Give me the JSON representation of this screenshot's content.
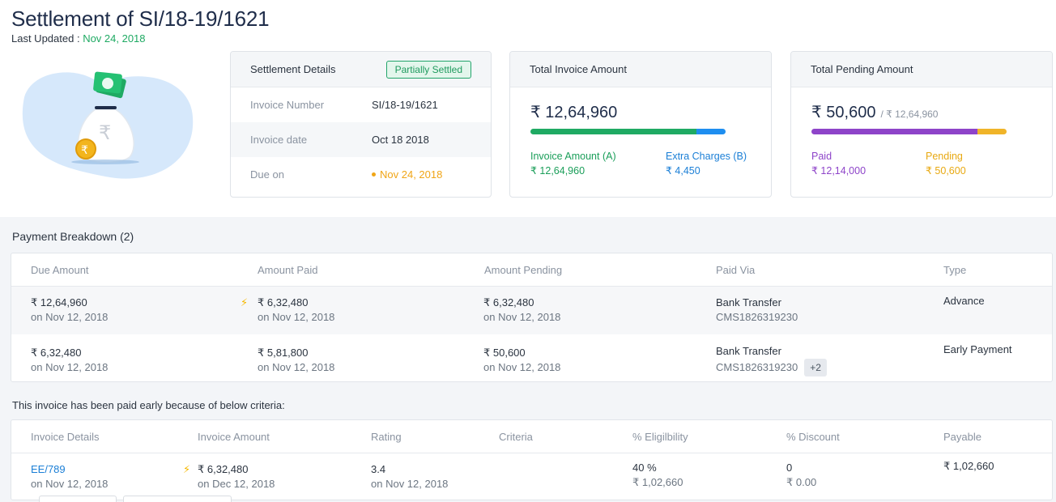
{
  "header": {
    "title": "Settlement of SI/18-19/1621",
    "last_updated_label": "Last Updated :",
    "last_updated_value": "Nov 24, 2018"
  },
  "colors": {
    "green": "#1faa63",
    "blue": "#1b7fd6",
    "purple": "#8e44c9",
    "amber": "#f0b429",
    "text": "#2b3440"
  },
  "settlement_card": {
    "title": "Settlement Details",
    "status_badge": "Partially Settled",
    "rows": [
      {
        "label": "Invoice Number",
        "value": "SI/18-19/1621"
      },
      {
        "label": "Invoice date",
        "value": "Oct 18 2018"
      },
      {
        "label": "Due on",
        "value": "Nov 24, 2018"
      }
    ]
  },
  "total_invoice_card": {
    "title": "Total Invoice Amount",
    "amount": "₹ 12,64,960",
    "bar_fraction_invoice": 0.85,
    "legend": [
      {
        "label": "Invoice Amount (A)",
        "value": "₹ 12,64,960"
      },
      {
        "label": "Extra Charges (B)",
        "value": "₹ 4,450"
      }
    ]
  },
  "total_pending_card": {
    "title": "Total Pending Amount",
    "amount": "₹ 50,600",
    "of_total": "/ ₹ 12,64,960",
    "bar_fraction_paid": 0.85,
    "legend": [
      {
        "label": "Paid",
        "value": "₹ 12,14,000"
      },
      {
        "label": "Pending",
        "value": "₹ 50,600"
      }
    ]
  },
  "payment_breakdown": {
    "title": "Payment Breakdown (2)",
    "columns": [
      "Due Amount",
      "Amount Paid",
      "Amount Pending",
      "Paid Via",
      "Type"
    ],
    "rows": [
      {
        "due_amount": "₹ 12,64,960",
        "due_date": "on Nov 12, 2018",
        "paid_amount": "₹ 6,32,480",
        "paid_date": "on Nov 12, 2018",
        "pending_amount": "₹ 6,32,480",
        "pending_date": "on Nov 12, 2018",
        "via": "Bank Transfer",
        "ref": "CMS1826319230",
        "type": "Advance"
      },
      {
        "due_amount": "₹ 6,32,480",
        "due_date": "on Nov 12, 2018",
        "paid_amount": "₹ 5,81,800",
        "paid_date": "on Nov 12, 2018",
        "pending_amount": "₹ 50,600",
        "pending_date": "on Nov 12, 2018",
        "via": "Bank Transfer",
        "ref": "CMS1826319230",
        "more": "+2",
        "type": "Early Payment"
      }
    ]
  },
  "criteria": {
    "note": "This invoice has been paid early because of below criteria:",
    "columns": [
      "Invoice Details",
      "Invoice Amount",
      "Rating",
      "Criteria",
      "% Eligilbility",
      "% Discount",
      "Payable"
    ],
    "row": {
      "invoice": "EE/789",
      "invoice_date": "on Nov 12, 2018",
      "amount": "₹ 6,32,480",
      "amount_date": "on Dec 12, 2018",
      "rating": "3.4",
      "rating_date": "on Nov 12, 2018",
      "eligibility": "40 %",
      "eligibility_amt": "₹ 1,02,660",
      "discount": "0",
      "discount_amt": "₹ 0.00",
      "payable": "₹ 1,02,660"
    }
  },
  "illustration": {
    "icon": "money-bag-icon",
    "bag_symbol": "₹",
    "coin_symbol": "₹"
  }
}
